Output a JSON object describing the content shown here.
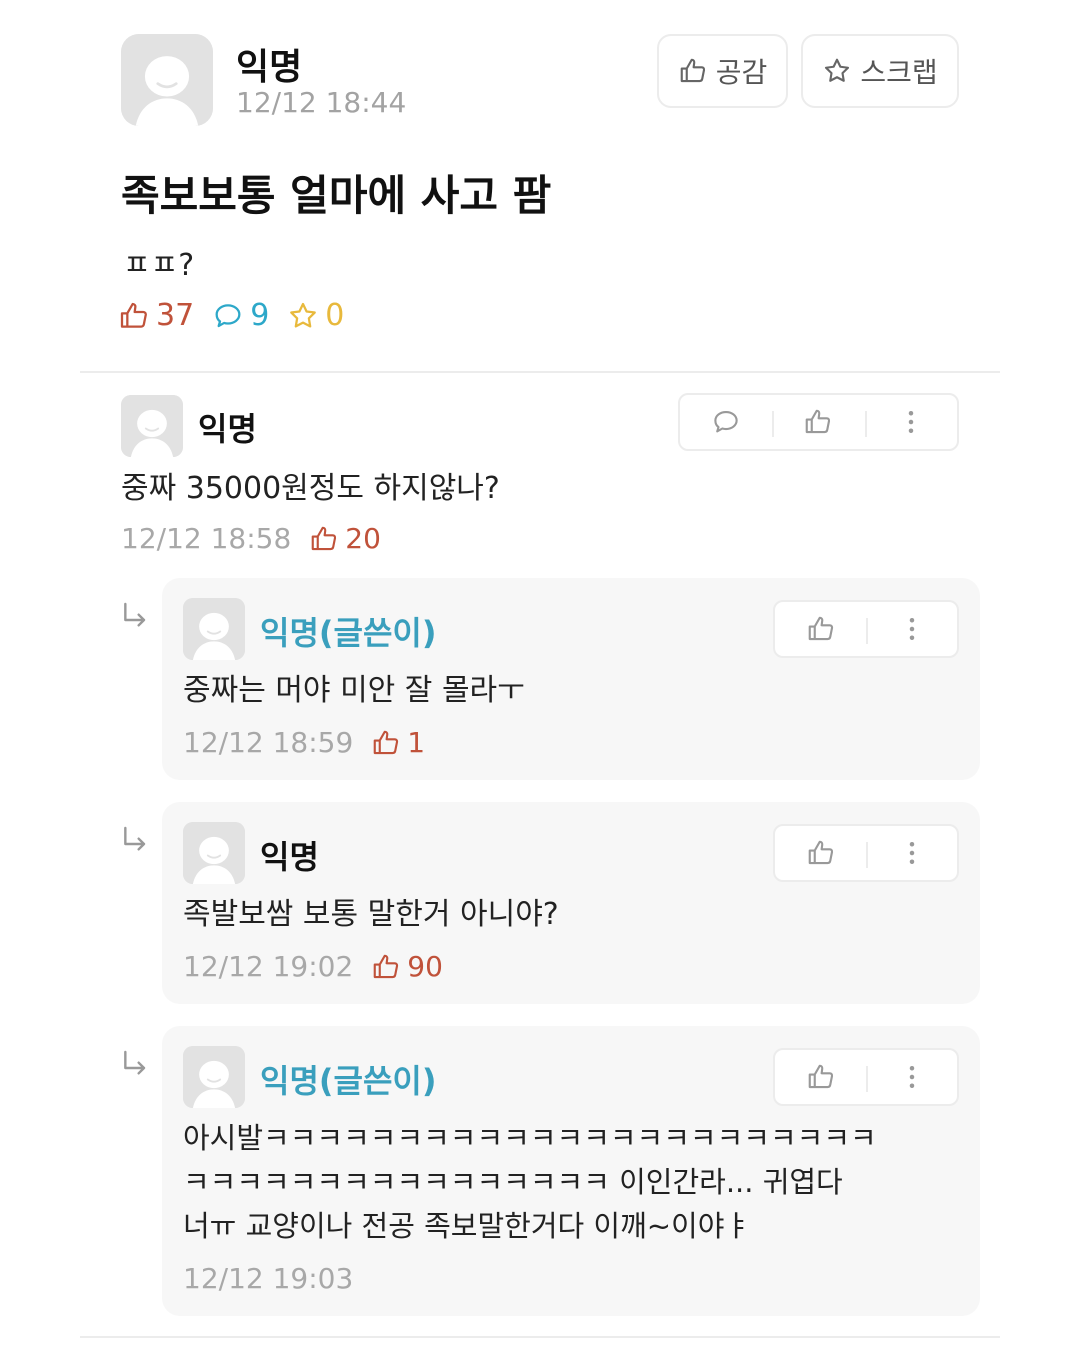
{
  "post": {
    "author": "익명",
    "time": "12/12 18:44",
    "title": "족보보통 얼마에 사고 팜",
    "body": "ㅍㅍ?",
    "like_count": "37",
    "comment_count": "9",
    "scrap_count": "0",
    "like_button": "공감",
    "scrap_button": "스크랩"
  },
  "comments": [
    {
      "author": "익명",
      "text": "중짜 35000원정도 하지않나?",
      "time": "12/12 18:58",
      "likes": "20"
    }
  ],
  "replies": [
    {
      "author": "익명(글쓴이)",
      "text_lines": [
        "중짜는 머야 미안 잘 몰라ㅜ"
      ],
      "time": "12/12 18:59",
      "likes": "1"
    },
    {
      "author": "익명",
      "text_lines": [
        "족발보쌈 보통 말한거 아니야?"
      ],
      "time": "12/12 19:02",
      "likes": "90"
    },
    {
      "author": "익명(글쓴이)",
      "text_lines": [
        "아시발ㅋㅋㅋㅋㅋㅋㅋㅋㅋㅋㅋㅋㅋㅋㅋㅋㅋㅋㅋㅋㅋㅋㅋ",
        "ㅋㅋㅋㅋㅋㅋㅋㅋㅋㅋㅋㅋㅋㅋㅋㅋ 이인간라... 귀엽다",
        "너ㅠ 교양이나 전공 족보말한거다 이깨~이야ㅑ"
      ],
      "time": "12/12 19:03",
      "likes": ""
    }
  ],
  "colors": {
    "accent_like": "#c0523a",
    "accent_comment": "#2da8c9",
    "accent_scrap": "#e8b93c",
    "op_name": "#3a9fbd"
  },
  "icons": [
    "thumbs-up-icon",
    "star-icon",
    "speech-bubble-icon",
    "more-vertical-icon",
    "reply-arrow-icon"
  ]
}
